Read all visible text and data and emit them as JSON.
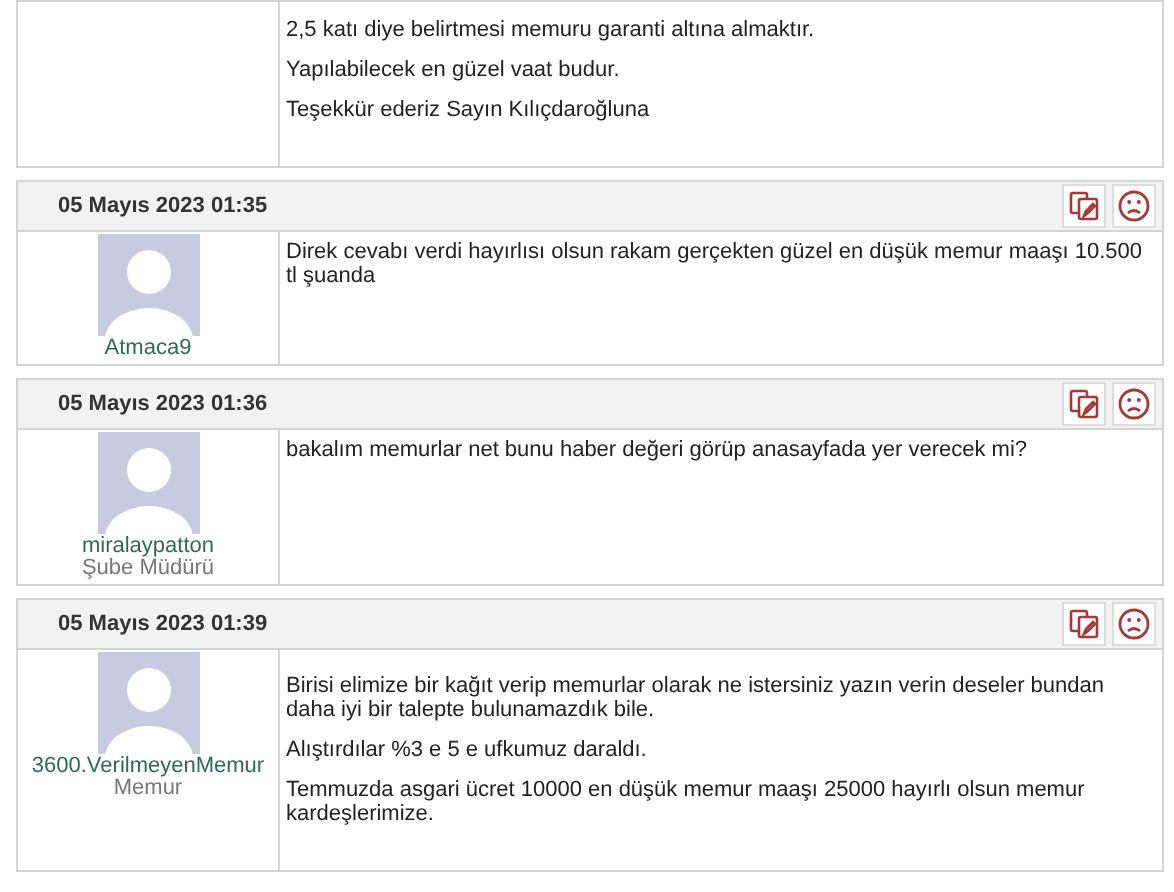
{
  "partial_post": {
    "paragraphs": [
      "2,5 katı diye belirtmesi memuru garanti altına almaktır.",
      "Yapılabilecek en güzel vaat budur.",
      "Teşekkür ederiz Sayın Kılıçdaroğluna"
    ]
  },
  "posts": [
    {
      "date": "05 Mayıs 2023 01:35",
      "username": "Atmaca9",
      "paragraphs": [
        "Direk cevabı verdi hayırlısı olsun rakam gerçekten güzel en düşük memur maaşı 10.500 tl şuanda"
      ]
    },
    {
      "date": "05 Mayıs 2023 01:36",
      "username": "miralaypatton",
      "role": "Şube Müdürü",
      "paragraphs": [
        "bakalım memurlar net bunu haber değeri görüp anasayfada yer verecek mi?"
      ]
    },
    {
      "date": "05 Mayıs 2023 01:39",
      "username": "3600.VerilmeyenMemur",
      "role": "Memur",
      "paragraphs": [
        "Birisi elimize bir kağıt verip memurlar olarak ne istersiniz yazın verin deseler bundan daha iyi bir talepte bulunamazdık bile.",
        "Alıştırdılar %3 e 5 e ufkumuz daraldı.",
        "Temmuzda asgari ücret 10000 en düşük memur maaşı 25000 hayırlı olsun memur kardeşlerimize."
      ]
    }
  ]
}
